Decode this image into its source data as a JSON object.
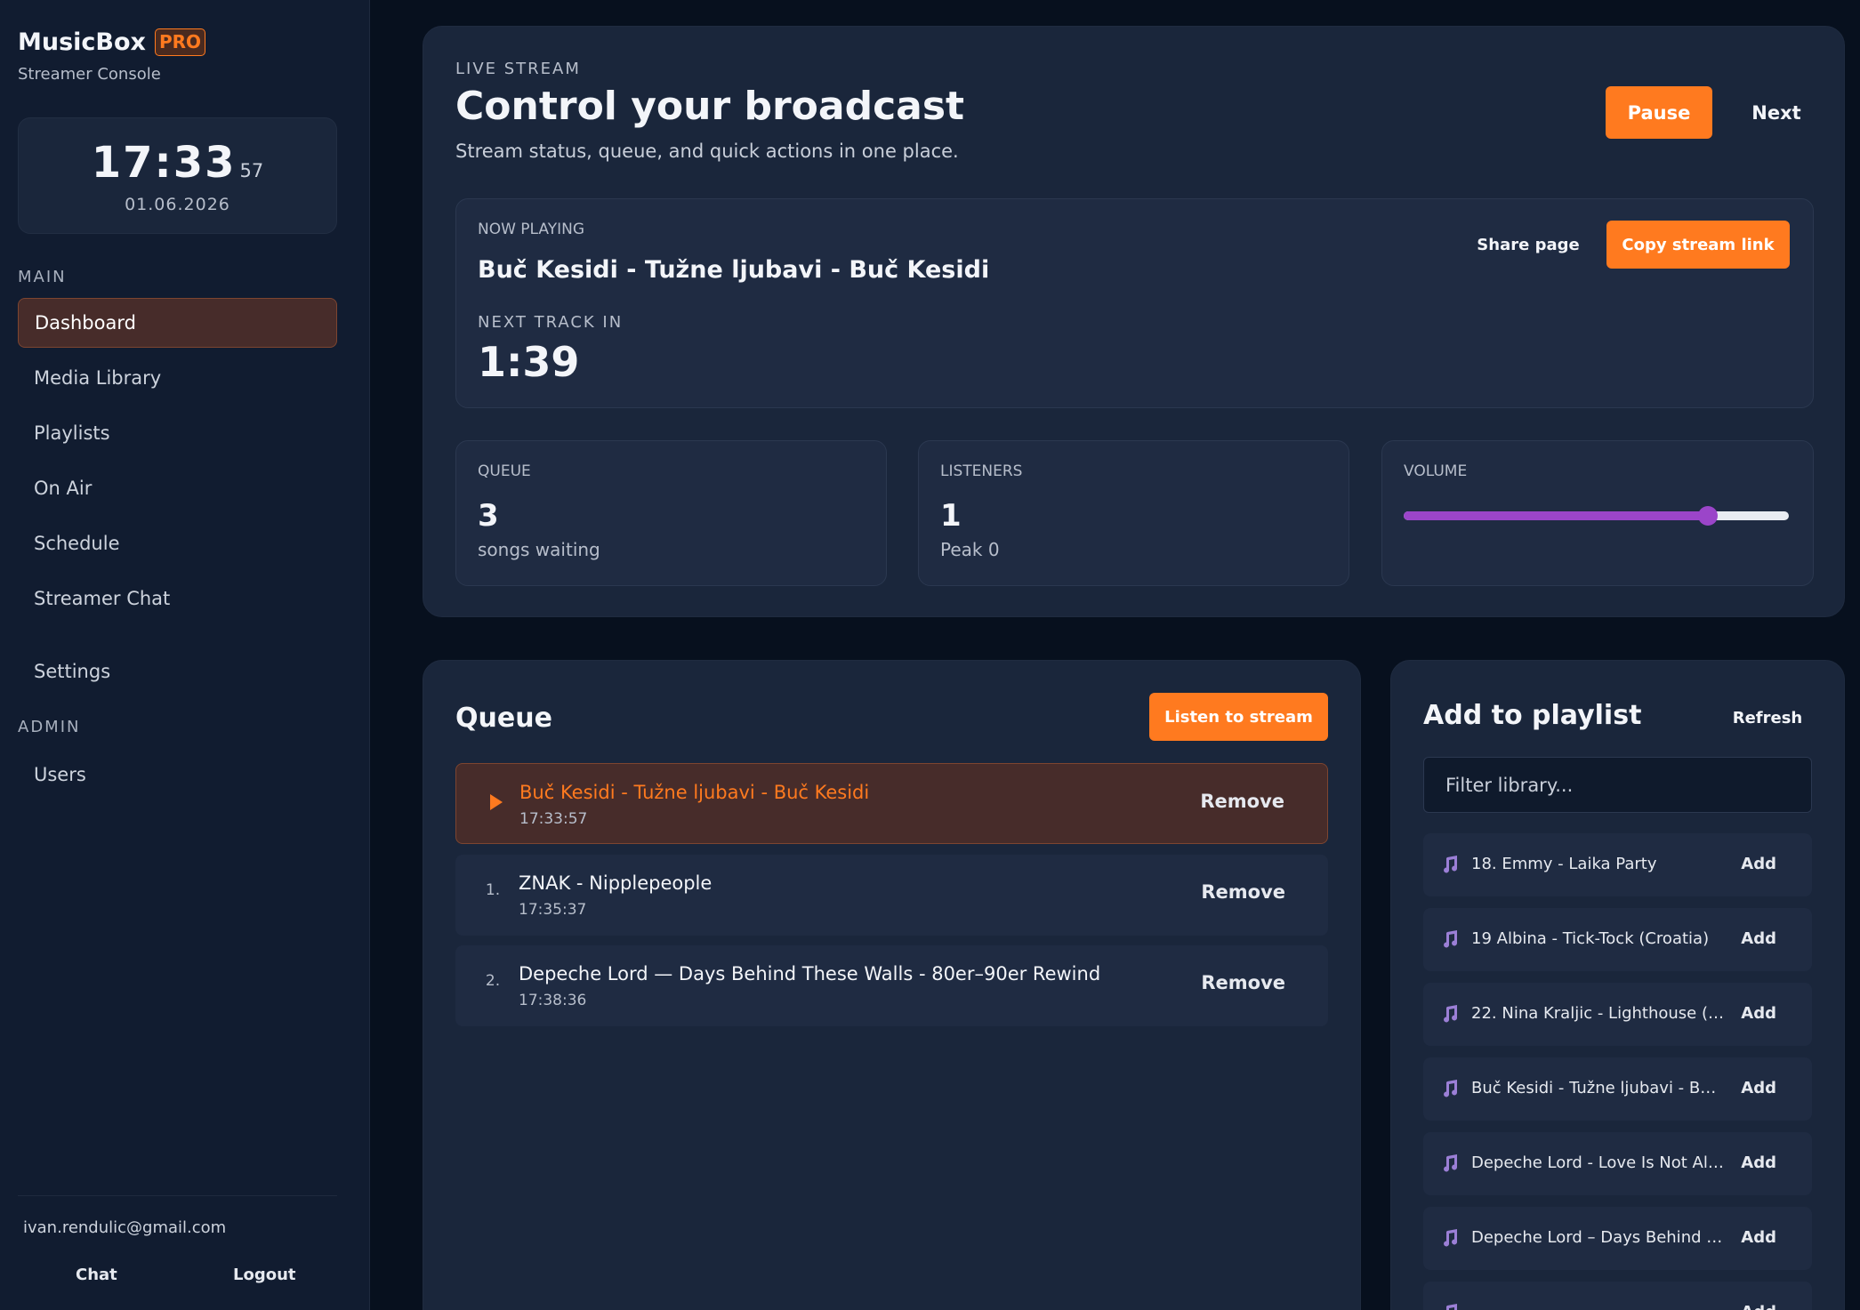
{
  "sidebar": {
    "brand_name": "MusicBox",
    "brand_badge": "PRO",
    "brand_sub": "Streamer Console",
    "clock": {
      "time": "17:33",
      "seconds": "57",
      "date": "01.06.2026"
    },
    "section_main": "MAIN",
    "section_admin": "ADMIN",
    "items": [
      {
        "label": "Dashboard"
      },
      {
        "label": "Media Library"
      },
      {
        "label": "Playlists"
      },
      {
        "label": "On Air"
      },
      {
        "label": "Schedule"
      },
      {
        "label": "Streamer Chat"
      },
      {
        "label": "Settings"
      }
    ],
    "admin_items": [
      {
        "label": "Users"
      }
    ],
    "user_email": "ivan.rendulic@gmail.com",
    "chat_label": "Chat",
    "logout_label": "Logout"
  },
  "hero": {
    "eyebrow": "LIVE STREAM",
    "title": "Control your broadcast",
    "subtitle": "Stream status, queue, and quick actions in one place.",
    "pause_label": "Pause",
    "next_label": "Next"
  },
  "now_playing": {
    "label": "NOW PLAYING",
    "title": "Buč Kesidi - Tužne ljubavi - Buč Kesidi",
    "next_label": "NEXT TRACK IN",
    "countdown": "1:39",
    "share_label": "Share page",
    "copy_label": "Copy stream link"
  },
  "stats": {
    "queue": {
      "label": "QUEUE",
      "value": "3",
      "sub": "songs waiting"
    },
    "listeners": {
      "label": "LISTENERS",
      "value": "1",
      "sub": "Peak 0"
    },
    "volume": {
      "label": "VOLUME",
      "level": 0.79
    }
  },
  "queue": {
    "title": "Queue",
    "listen_label": "Listen to stream",
    "remove_label": "Remove",
    "rows": [
      {
        "index": "",
        "title": "Buč Kesidi - Tužne ljubavi - Buč Kesidi",
        "time": "17:33:57",
        "current": true
      },
      {
        "index": "1.",
        "title": "ZNAK - Nipplepeople",
        "time": "17:35:37"
      },
      {
        "index": "2.",
        "title": "Depeche Lord — Days Behind These Walls - 80er–90er Rewind",
        "time": "17:38:36"
      }
    ]
  },
  "playlist": {
    "title": "Add to playlist",
    "refresh_label": "Refresh",
    "filter_placeholder": "Filter library...",
    "add_label": "Add",
    "items": [
      {
        "title": "18. Emmy - Laika Party"
      },
      {
        "title": "19 Albina - Tick-Tock (Croatia)"
      },
      {
        "title": "22. Nina Kraljic - Lighthouse (Eur..."
      },
      {
        "title": "Buč Kesidi - Tužne ljubavi - Buč ..."
      },
      {
        "title": "Depeche Lord - Love Is Not Alw..."
      },
      {
        "title": "Depeche Lord – Days Behind Th..."
      },
      {
        "title": ""
      }
    ]
  },
  "colors": {
    "accent": "#ff7a1f",
    "volume": "#9b45c9",
    "note_icon": "#9b7fd6"
  }
}
